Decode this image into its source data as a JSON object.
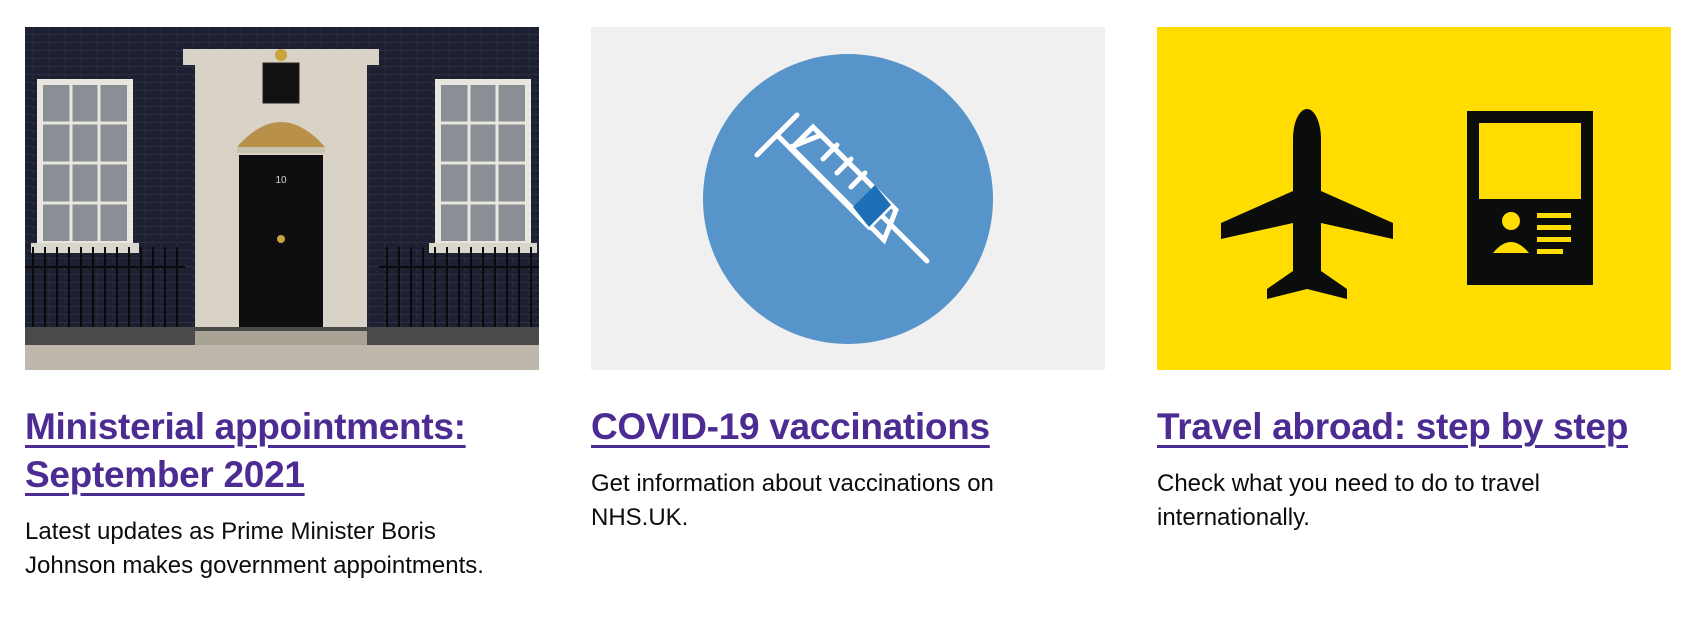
{
  "cards": [
    {
      "image_alt": "Door of 10 Downing Street",
      "door_number": "10",
      "title": "Ministerial appointments: September 2021",
      "description": "Latest updates as Prime Minister Boris Johnson makes government appointments.",
      "image_bg": "#1d2233"
    },
    {
      "image_alt": "Vaccine syringe illustration",
      "title": "COVID-19 vaccinations",
      "description": "Get information about vaccinations on NHS.UK.",
      "image_bg": "#f0f0f0",
      "circle_color": "#5694ca"
    },
    {
      "image_alt": "Aeroplane and passport illustration",
      "title": "Travel abroad: step by step",
      "description": "Check what you need to do to travel internationally.",
      "image_bg": "#ffdd00"
    }
  ],
  "colors": {
    "link": "#4c2c92",
    "text": "#0b0c0c"
  }
}
